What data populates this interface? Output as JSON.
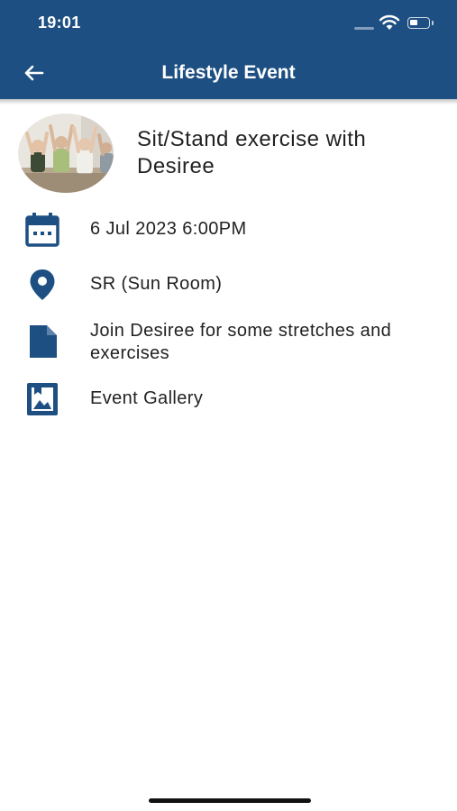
{
  "status_bar": {
    "time": "19:01"
  },
  "header": {
    "title": "Lifestyle Event",
    "back_icon": "arrow-left-icon"
  },
  "event": {
    "title": "Sit/Stand exercise with Desiree",
    "image": "exercise-class-photo"
  },
  "details": [
    {
      "icon": "calendar-icon",
      "text": "6 Jul 2023 6:00PM"
    },
    {
      "icon": "location-pin-icon",
      "text": "SR (Sun Room)"
    },
    {
      "icon": "document-icon",
      "text": "Join Desiree for some stretches and exercises"
    },
    {
      "icon": "gallery-icon",
      "text": "Event Gallery"
    }
  ],
  "colors": {
    "header": "#1d4f82",
    "icon": "#1d4f82",
    "text": "#222222",
    "background": "#ffffff"
  }
}
